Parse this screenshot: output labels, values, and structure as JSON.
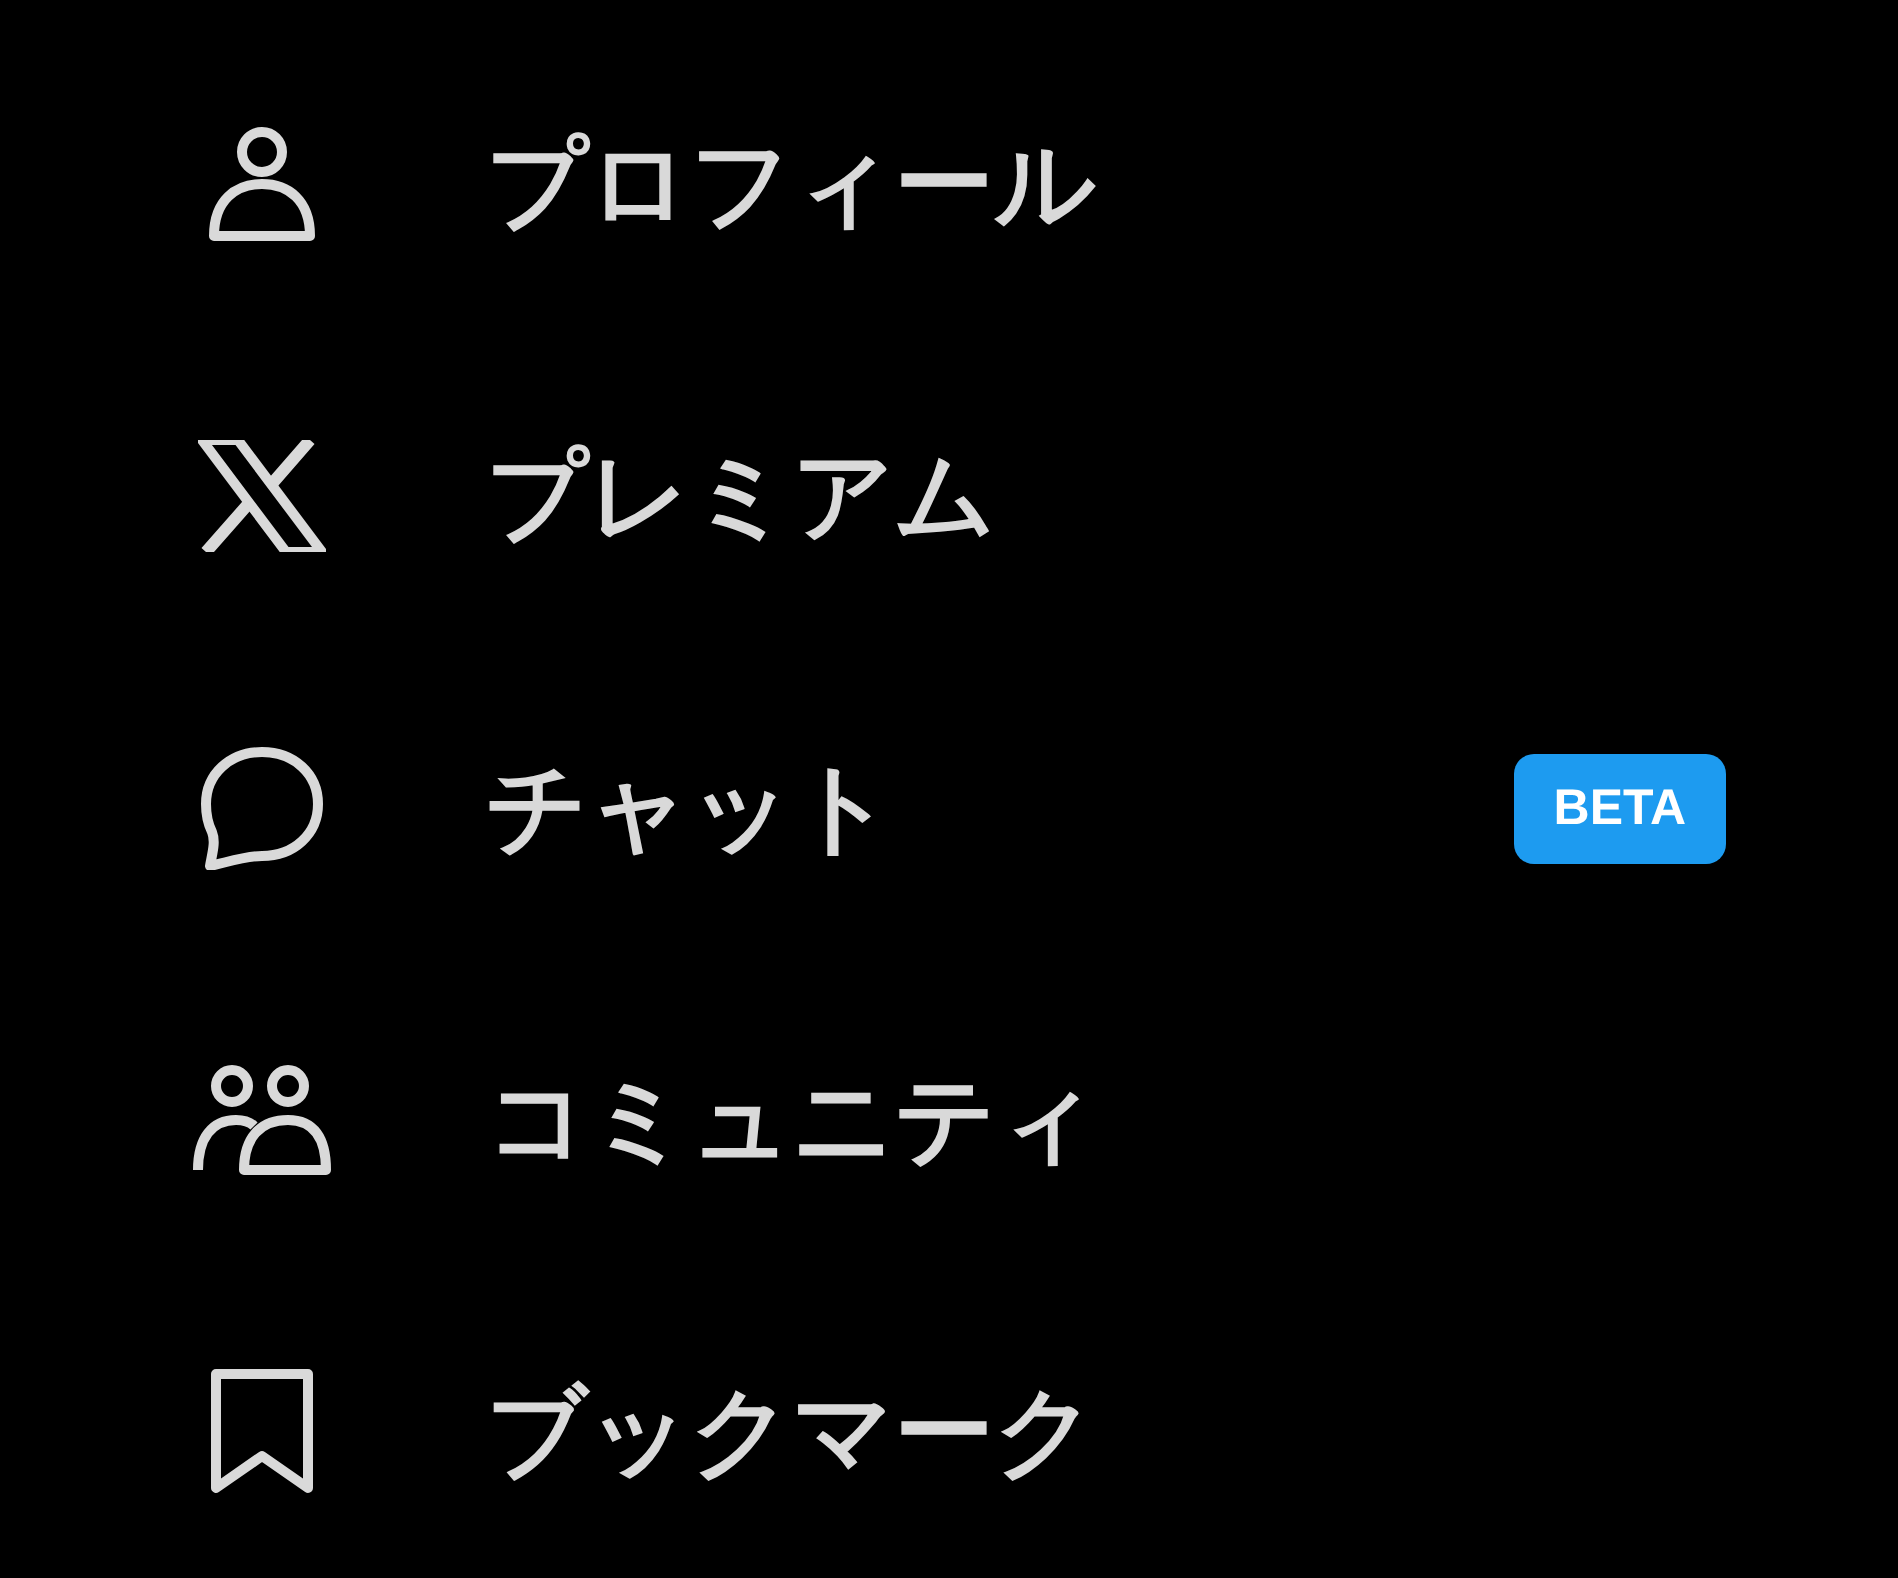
{
  "menu_items": [
    {
      "label": "プロフィール"
    },
    {
      "label": "プレミアム"
    },
    {
      "label": "チャット",
      "badge": "BETA"
    },
    {
      "label": "コミュニティ"
    },
    {
      "label": "ブックマーク"
    }
  ]
}
